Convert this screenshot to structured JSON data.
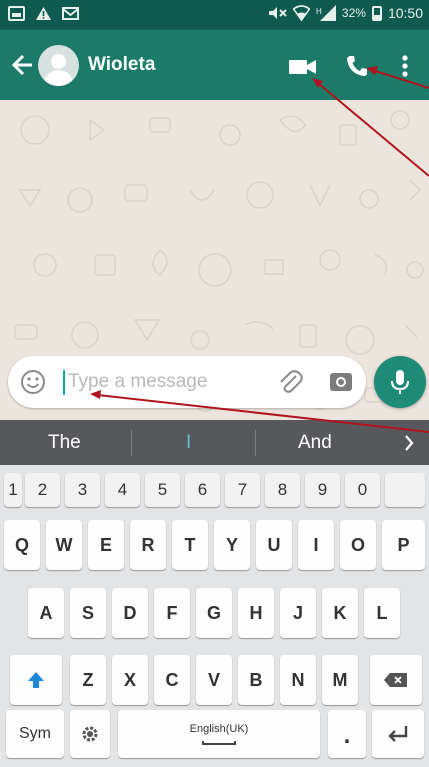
{
  "status_bar": {
    "battery": "32%",
    "time": "10:50"
  },
  "header": {
    "contact_name": "Wioleta"
  },
  "composer": {
    "placeholder": "Type a message"
  },
  "keyboard": {
    "suggestions": [
      "The",
      "I",
      "And"
    ],
    "number_row": [
      "1",
      "2",
      "3",
      "4",
      "5",
      "6",
      "7",
      "8",
      "9",
      "0"
    ],
    "row1": [
      "Q",
      "W",
      "E",
      "R",
      "T",
      "Y",
      "U",
      "I",
      "O",
      "P"
    ],
    "row2": [
      "A",
      "S",
      "D",
      "F",
      "G",
      "H",
      "J",
      "K",
      "L"
    ],
    "row3": [
      "Z",
      "X",
      "C",
      "V",
      "B",
      "N",
      "M"
    ],
    "sym_label": "Sym",
    "space_label": "English(UK)",
    "period": "."
  },
  "colors": {
    "status_bar": "#0f5a4e",
    "app_bar": "#1b7a68",
    "mic_fab": "#1d8b76",
    "annotation_arrow": "#b0141c",
    "shift_arrow": "#1e88d8"
  }
}
